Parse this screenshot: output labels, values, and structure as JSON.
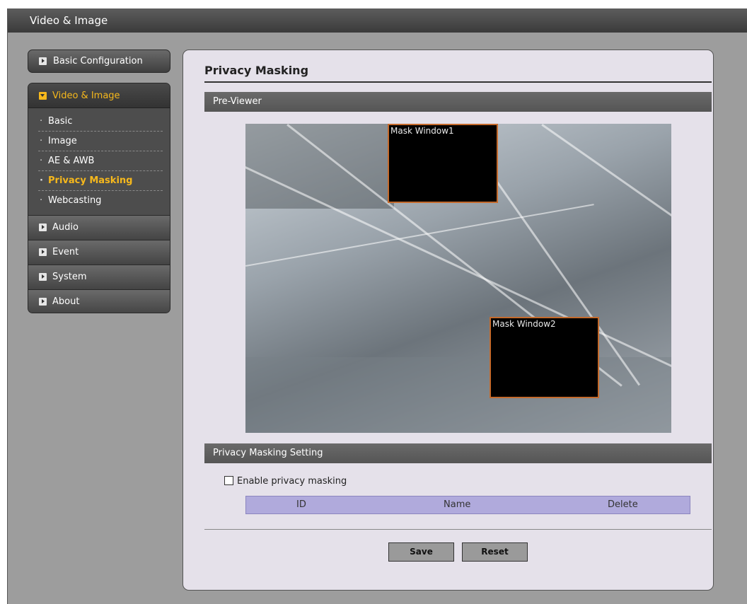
{
  "window": {
    "title": "Video & Image"
  },
  "sidebar": {
    "basic_configuration": "Basic Configuration",
    "video_image": {
      "label": "Video & Image",
      "items": [
        "Basic",
        "Image",
        "AE & AWB",
        "Privacy Masking",
        "Webcasting"
      ],
      "active_item": "Privacy Masking"
    },
    "audio": "Audio",
    "event": "Event",
    "system": "System",
    "about": "About"
  },
  "main": {
    "title": "Privacy Masking",
    "preview_section": "Pre-Viewer",
    "masks": [
      {
        "label": "Mask Window1"
      },
      {
        "label": "Mask Window2"
      }
    ],
    "setting_section": "Privacy Masking Setting",
    "enable_label": "Enable privacy masking",
    "enable_checked": false,
    "table_headers": {
      "id": "ID",
      "name": "Name",
      "delete": "Delete"
    },
    "save_label": "Save",
    "reset_label": "Reset"
  },
  "colors": {
    "accent": "#f6b81c",
    "panel_bg": "#e5e1ea",
    "mask_border": "#c46a2c",
    "table_header_bg": "#b0aadc"
  }
}
